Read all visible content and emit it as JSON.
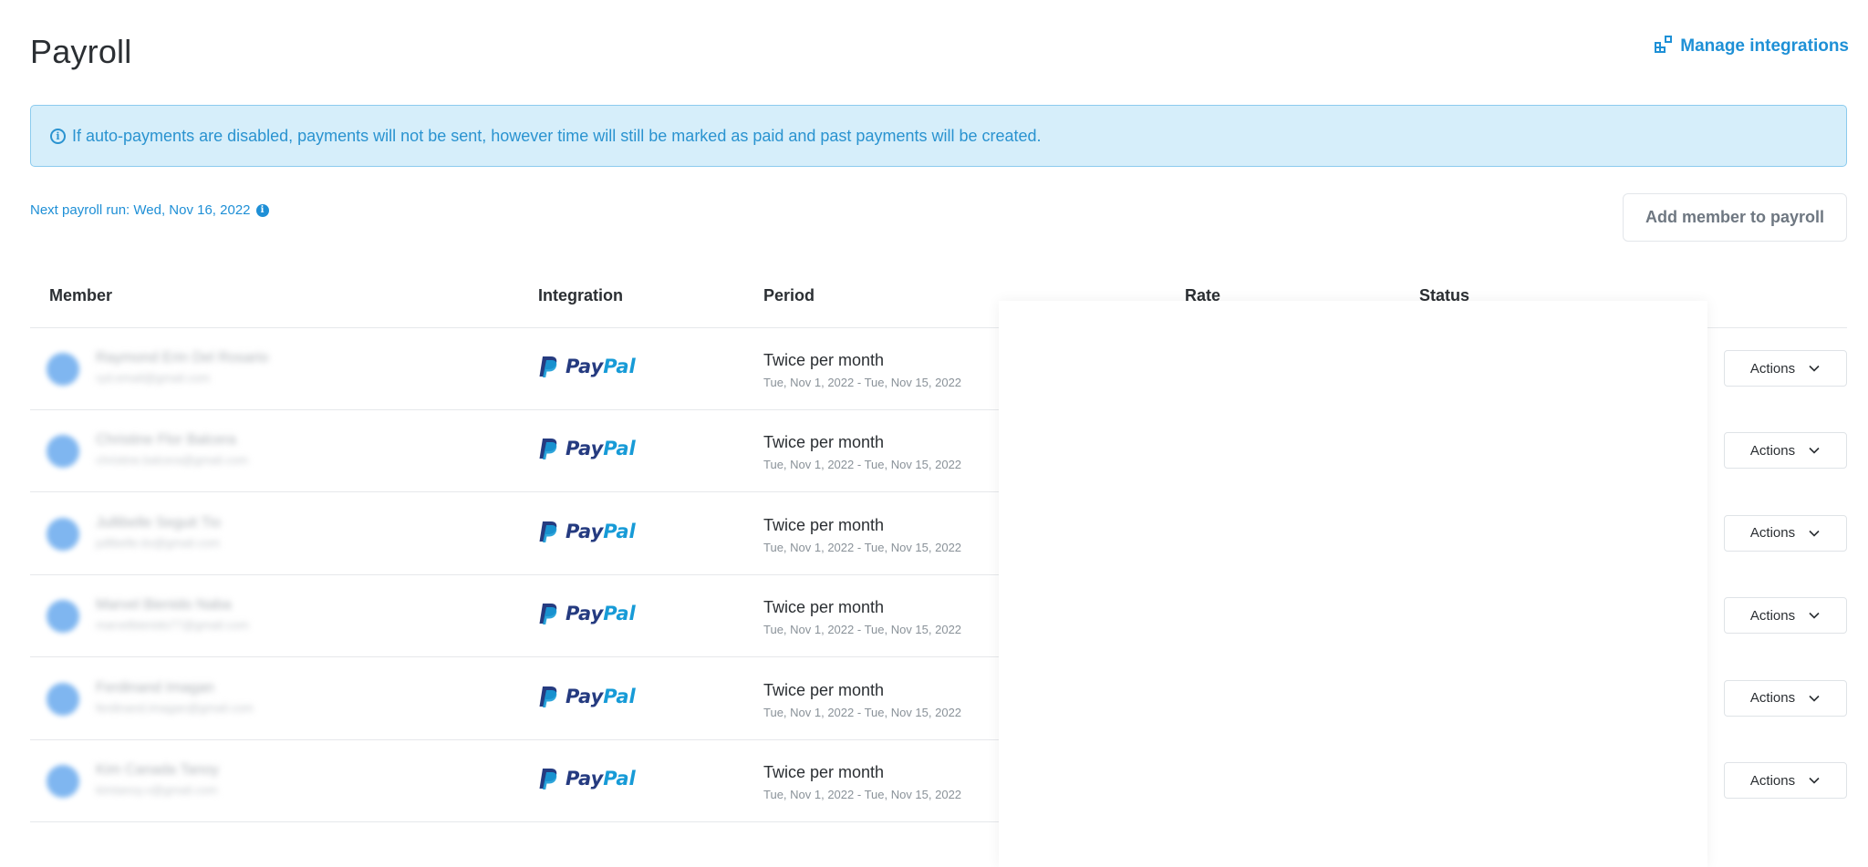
{
  "page": {
    "title": "Payroll",
    "manage_integrations": "Manage integrations",
    "manage_icon": "integrations-icon"
  },
  "banner": {
    "icon": "info-icon",
    "text": "If auto-payments are disabled, payments will not be sent, however time will still be marked as paid and past payments will be created."
  },
  "next_run": {
    "text": "Next payroll run: Wed, Nov 16, 2022",
    "icon": "info-icon"
  },
  "add_member_button": "Add member to payroll",
  "table": {
    "headers": {
      "member": "Member",
      "integration": "Integration",
      "period": "Period",
      "rate": "Rate",
      "status": "Status"
    },
    "rows": [
      {
        "name": "Raymond Erin Del Rosario",
        "email": "ryd.email@gmail.com",
        "integration": "PayPal",
        "period": "Twice per month",
        "range": "Tue, Nov 1, 2022 - Tue, Nov 15, 2022",
        "action": "Actions"
      },
      {
        "name": "Christine Flor Balcera",
        "email": "christine.balcera@gmail.com",
        "integration": "PayPal",
        "period": "Twice per month",
        "range": "Tue, Nov 1, 2022 - Tue, Nov 15, 2022",
        "action": "Actions"
      },
      {
        "name": "Jullibelle Seguit Tio",
        "email": "jullibelle.tio@gmail.com",
        "integration": "PayPal",
        "period": "Twice per month",
        "range": "Tue, Nov 1, 2022 - Tue, Nov 15, 2022",
        "action": "Actions"
      },
      {
        "name": "Marvel Bienido Naba",
        "email": "marvelbienido77@gmail.com",
        "integration": "PayPal",
        "period": "Twice per month",
        "range": "Tue, Nov 1, 2022 - Tue, Nov 15, 2022",
        "action": "Actions"
      },
      {
        "name": "Ferdinand Imagan",
        "email": "ferdinand.imagan@gmail.com",
        "integration": "PayPal",
        "period": "Twice per month",
        "range": "Tue, Nov 1, 2022 - Tue, Nov 15, 2022",
        "action": "Actions"
      },
      {
        "name": "Kim Canada Tanoy",
        "email": "kimtanoy.v@gmail.com",
        "integration": "PayPal",
        "period": "Twice per month",
        "range": "Tue, Nov 1, 2022 - Tue, Nov 15, 2022",
        "action": "Actions"
      }
    ]
  },
  "colors": {
    "accent": "#1e90d6",
    "banner_bg": "#d6eefa",
    "paypal_dark": "#253b80",
    "paypal_light": "#179bd7"
  }
}
